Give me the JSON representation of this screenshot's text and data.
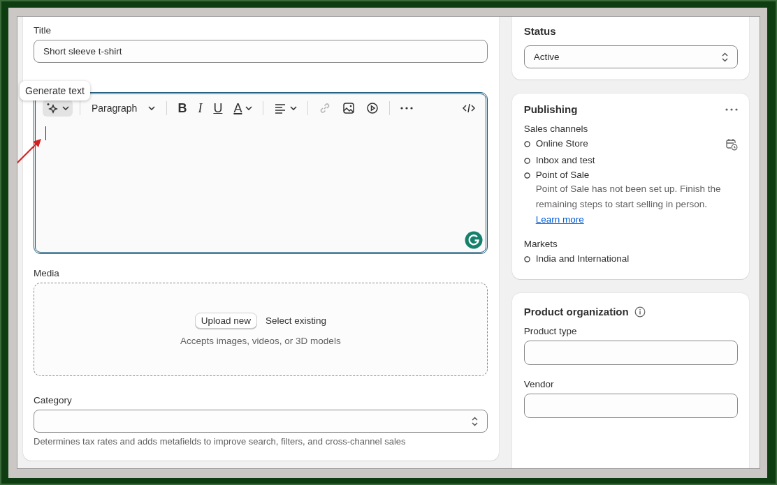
{
  "title_field": {
    "label": "Title",
    "value": "Short sleeve t-shirt"
  },
  "tooltip": {
    "text": "Generate text"
  },
  "editor": {
    "focused": true,
    "toolbar": [
      {
        "kind": "sparkle",
        "disabled": false,
        "selected": true
      },
      {
        "kind": "dropdown",
        "text": "Paragraph",
        "disabled": false,
        "selected": false
      },
      {
        "kind": "bold",
        "text": "B",
        "disabled": false,
        "selected": false
      },
      {
        "kind": "italic",
        "text": "I",
        "disabled": false,
        "selected": false
      },
      {
        "kind": "underline",
        "text": "U",
        "disabled": false,
        "selected": false
      },
      {
        "kind": "color",
        "text": "A",
        "disabled": false,
        "selected": false
      },
      {
        "kind": "align",
        "disabled": false,
        "selected": false
      },
      {
        "kind": "link",
        "disabled": true,
        "selected": false
      },
      {
        "kind": "image",
        "disabled": false,
        "selected": false
      },
      {
        "kind": "video",
        "disabled": false,
        "selected": false
      },
      {
        "kind": "more",
        "disabled": false,
        "selected": false
      },
      {
        "kind": "code",
        "disabled": false,
        "selected": false
      }
    ]
  },
  "media": {
    "label": "Media",
    "upload_button": "Upload new",
    "select_link": "Select existing",
    "hint": "Accepts images, videos, or 3D models"
  },
  "category": {
    "label": "Category",
    "help": "Determines tax rates and adds metafields to improve search, filters, and cross-channel sales"
  },
  "status": {
    "heading": "Status",
    "value": "Active"
  },
  "publishing": {
    "heading": "Publishing",
    "sales_channels_label": "Sales channels",
    "channels": [
      {
        "name": "Online Store",
        "scheduled": true
      },
      {
        "name": "Inbox and test",
        "scheduled": false
      },
      {
        "name": "Point of Sale",
        "scheduled": false,
        "note": "Point of Sale has not been set up. Finish the remaining steps to start selling in person.",
        "link": "Learn more"
      }
    ],
    "markets_label": "Markets",
    "markets": [
      {
        "name": "India and International"
      }
    ]
  },
  "product_organization": {
    "heading": "Product organization",
    "fields": [
      {
        "label": "Product type"
      },
      {
        "label": "Vendor"
      }
    ]
  }
}
